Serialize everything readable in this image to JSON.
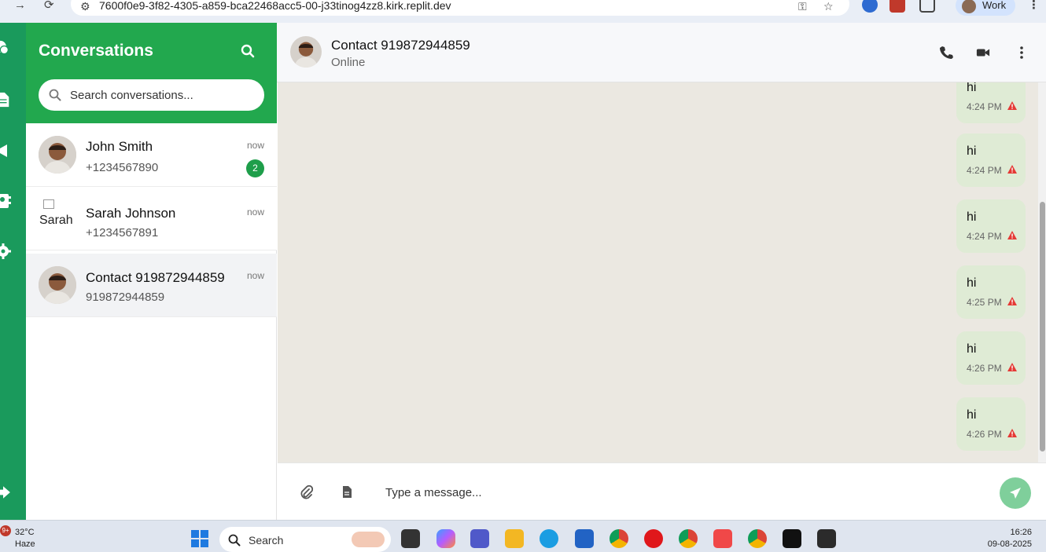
{
  "browser": {
    "url": "7600f0e9-3f82-4305-a859-bca22468acc5-00-j33tinog4zz8.kirk.replit.dev",
    "profile_label": "Work"
  },
  "sidebar": {
    "title": "Conversations",
    "search_placeholder": "Search conversations...",
    "conversations": [
      {
        "name": "John Smith",
        "phone": "+1234567890",
        "time": "now",
        "unread": "2"
      },
      {
        "name": "Sarah Johnson",
        "phone": "+1234567891",
        "time": "now",
        "avatar_alt": "Sarah"
      },
      {
        "name": "Contact 919872944859",
        "phone": "919872944859",
        "time": "now"
      }
    ]
  },
  "chat": {
    "contact_name": "Contact 919872944859",
    "status": "Online",
    "messages": [
      {
        "text": "hi",
        "time": "4:24 PM"
      },
      {
        "text": "hi",
        "time": "4:24 PM"
      },
      {
        "text": "hi",
        "time": "4:24 PM"
      },
      {
        "text": "hi",
        "time": "4:25 PM"
      },
      {
        "text": "hi",
        "time": "4:26 PM"
      },
      {
        "text": "hi",
        "time": "4:26 PM"
      }
    ],
    "input_placeholder": "Type a message..."
  },
  "taskbar": {
    "weather_temp": "32°C",
    "weather_desc": "Haze",
    "notification_count": "9+",
    "search_label": "Search",
    "time": "16:26",
    "date": "09-08-2025"
  },
  "colors": {
    "brand_green": "#22a84e",
    "rail_green": "#1a9a5c",
    "bubble": "#dfebd5",
    "chat_bg": "#ebe8e1",
    "warning_red": "#e53935"
  }
}
